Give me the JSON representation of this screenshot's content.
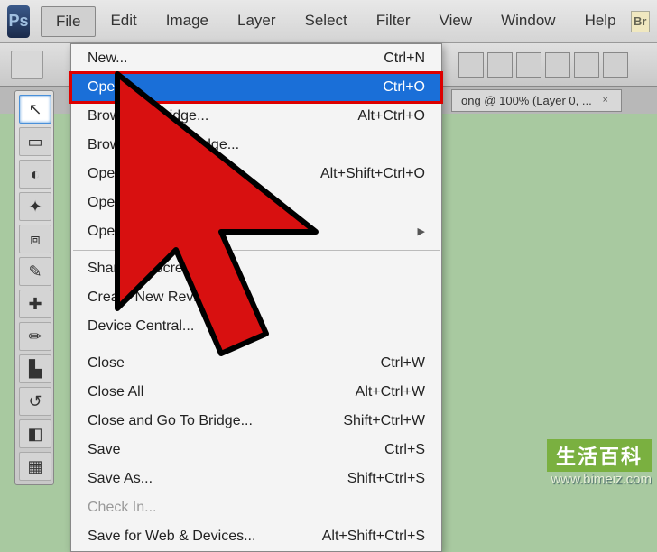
{
  "app": {
    "logo": "Ps",
    "br_badge": "Br"
  },
  "menubar": [
    "File",
    "Edit",
    "Image",
    "Layer",
    "Select",
    "Filter",
    "View",
    "Window",
    "Help"
  ],
  "menubar_active": "File",
  "document_tab": {
    "title": "ong @ 100% (Layer 0, ...",
    "close": "×"
  },
  "dropdown": [
    {
      "label": "New...",
      "shortcut": "Ctrl+N"
    },
    {
      "label": "Open...",
      "shortcut": "Ctrl+O",
      "highlight": true
    },
    {
      "label": "Browse in Bridge...",
      "shortcut": "Alt+Ctrl+O"
    },
    {
      "label": "Browse in Mini Bridge...",
      "shortcut": ""
    },
    {
      "label": "Open As...",
      "shortcut": "Alt+Shift+Ctrl+O"
    },
    {
      "label": "Open As Smart Object...",
      "shortcut": ""
    },
    {
      "label": "Open Recent",
      "shortcut": "",
      "submenu": true
    },
    {
      "sep": true
    },
    {
      "label": "Share My Screen...",
      "shortcut": ""
    },
    {
      "label": "Create New Review...",
      "shortcut": ""
    },
    {
      "label": "Device Central...",
      "shortcut": ""
    },
    {
      "sep": true
    },
    {
      "label": "Close",
      "shortcut": "Ctrl+W"
    },
    {
      "label": "Close All",
      "shortcut": "Alt+Ctrl+W"
    },
    {
      "label": "Close and Go To Bridge...",
      "shortcut": "Shift+Ctrl+W"
    },
    {
      "label": "Save",
      "shortcut": "Ctrl+S"
    },
    {
      "label": "Save As...",
      "shortcut": "Shift+Ctrl+S"
    },
    {
      "label": "Check In...",
      "shortcut": "",
      "disabled": true
    },
    {
      "label": "Save for Web & Devices...",
      "shortcut": "Alt+Shift+Ctrl+S"
    }
  ],
  "tools": [
    {
      "name": "move-tool",
      "glyph": "↖",
      "selected": true
    },
    {
      "name": "marquee-tool",
      "glyph": "▭"
    },
    {
      "name": "lasso-tool",
      "glyph": "◐"
    },
    {
      "name": "wand-tool",
      "glyph": "✦"
    },
    {
      "name": "crop-tool",
      "glyph": "⧈"
    },
    {
      "name": "eyedropper-tool",
      "glyph": "✎"
    },
    {
      "name": "healing-tool",
      "glyph": "✚"
    },
    {
      "name": "brush-tool",
      "glyph": "✏"
    },
    {
      "name": "stamp-tool",
      "glyph": "▙"
    },
    {
      "name": "history-brush-tool",
      "glyph": "↺"
    },
    {
      "name": "eraser-tool",
      "glyph": "◧"
    },
    {
      "name": "gradient-tool",
      "glyph": "▦"
    }
  ],
  "watermark": {
    "title": "生活百科",
    "url": "www.bimeiz.com"
  }
}
